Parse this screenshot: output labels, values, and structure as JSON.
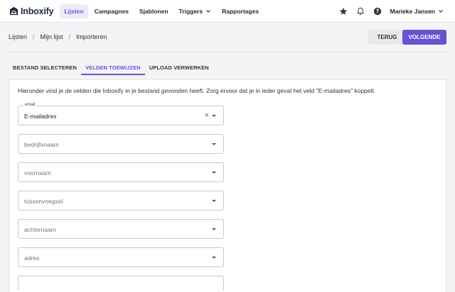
{
  "app": {
    "name": "Inboxify",
    "accent": "#6652d6"
  },
  "nav": {
    "items": [
      {
        "label": "Lijsten",
        "active": true
      },
      {
        "label": "Campagnes",
        "active": false
      },
      {
        "label": "Sjablonen",
        "active": false
      },
      {
        "label": "Triggers",
        "active": false,
        "dropdown": true
      },
      {
        "label": "Rapportages",
        "active": false
      }
    ],
    "icons": [
      "star-icon",
      "bell-icon",
      "help-icon"
    ],
    "user": "Marieke Jansen"
  },
  "breadcrumb": [
    "Lijsten",
    "Mijn lijst",
    "Importeren"
  ],
  "actions": {
    "back_label": "TERUG",
    "next_label": "VOLGENDE"
  },
  "tabs": [
    {
      "label": "BESTAND SELECTEREN",
      "active": false
    },
    {
      "label": "VELDEN TOEWIJZEN",
      "active": true
    },
    {
      "label": "UPLOAD VERWERKEN",
      "active": false
    }
  ],
  "intro_text": "Hieronder vind je de velden die Inboxify in je bestand gevonden heeft. Zorg ervoor dat je in ieder geval het veld \"E-mailadres\" koppelt.",
  "fields": [
    {
      "label": "email",
      "value": "E-mailadres"
    },
    {
      "placeholder": "bedrijfsnaam"
    },
    {
      "placeholder": "voornaam"
    },
    {
      "placeholder": "tussenvoegsel"
    },
    {
      "placeholder": "achternaam"
    },
    {
      "placeholder": "adres"
    }
  ]
}
